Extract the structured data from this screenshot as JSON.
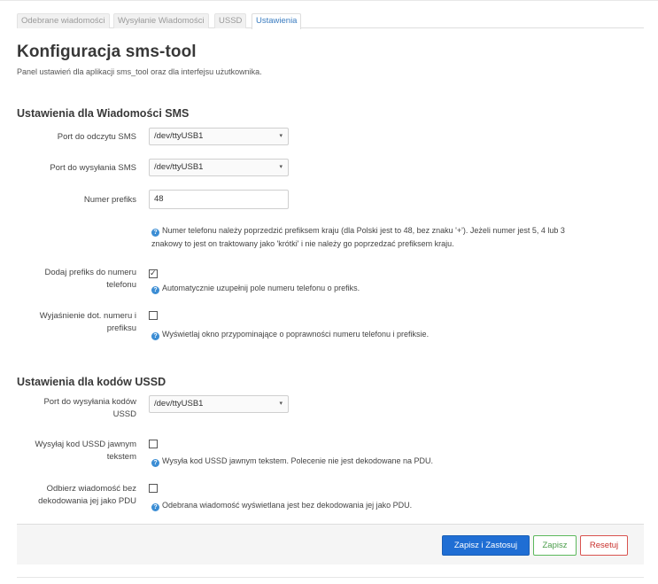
{
  "tabs": [
    {
      "label": "Odebrane wiadomości",
      "active": false
    },
    {
      "label": "Wysyłanie Wiadomości",
      "active": false
    },
    {
      "label": "USSD",
      "active": false
    },
    {
      "label": "Ustawienia",
      "active": true
    }
  ],
  "page": {
    "title": "Konfiguracja sms-tool",
    "description": "Panel ustawień dla aplikacji sms_tool oraz dla interfejsu użutkownika."
  },
  "sms_section": {
    "heading": "Ustawienia dla Wiadomości SMS",
    "read_port": {
      "label": "Port do odczytu SMS",
      "value": "/dev/ttyUSB1"
    },
    "send_port": {
      "label": "Port do wysyłania SMS",
      "value": "/dev/ttyUSB1"
    },
    "prefix": {
      "label": "Numer prefiks",
      "value": "48",
      "help_line1": "Numer telefonu należy poprzedzić prefiksem kraju (dla Polski jest to 48, bez znaku '+'). Jeżeli numer jest 5, 4 lub 3",
      "help_line2": "znakowy to jest on traktowany jako 'krótki' i nie należy go poprzedzać prefiksem kraju."
    },
    "add_prefix": {
      "label_line1": "Dodaj prefiks do numeru",
      "label_line2": "telefonu",
      "checked": true,
      "help": "Automatycznie uzupełnij pole numeru telefonu o prefiks."
    },
    "explain": {
      "label_line1": "Wyjaśnienie dot. numeru i",
      "label_line2": "prefiksu",
      "checked": false,
      "help": "Wyświetlaj okno przypominające o poprawności numeru telefonu i prefiksie."
    }
  },
  "ussd_section": {
    "heading": "Ustawienia dla kodów USSD",
    "send_port": {
      "label_line1": "Port do wysyłania kodów",
      "label_line2": "USSD",
      "value": "/dev/ttyUSB1"
    },
    "plain_text": {
      "label_line1": "Wysyłaj kod USSD jawnym",
      "label_line2": "tekstem",
      "checked": false,
      "help": "Wysyła kod USSD jawnym tekstem. Polecenie nie jest dekodowane na PDU."
    },
    "no_decode": {
      "label_line1": "Odbierz wiadomość bez",
      "label_line2": "dekodowania jej jako PDU",
      "checked": false,
      "help": "Odebrana wiadomość wyświetlana jest bez dekodowania jej jako PDU."
    }
  },
  "actions": {
    "save_apply": "Zapisz i Zastosuj",
    "save": "Zapisz",
    "reset": "Resetuj"
  },
  "icons": {
    "select_caret": "▾",
    "check_mark": "✓",
    "help_icon": "?"
  },
  "colors": {
    "primary": "#1f6ed4",
    "save_green": "#5cb85c",
    "reset_red": "#d9534f",
    "active_tab": "#3a7cc0",
    "help_icon": "#3b8dd4"
  }
}
